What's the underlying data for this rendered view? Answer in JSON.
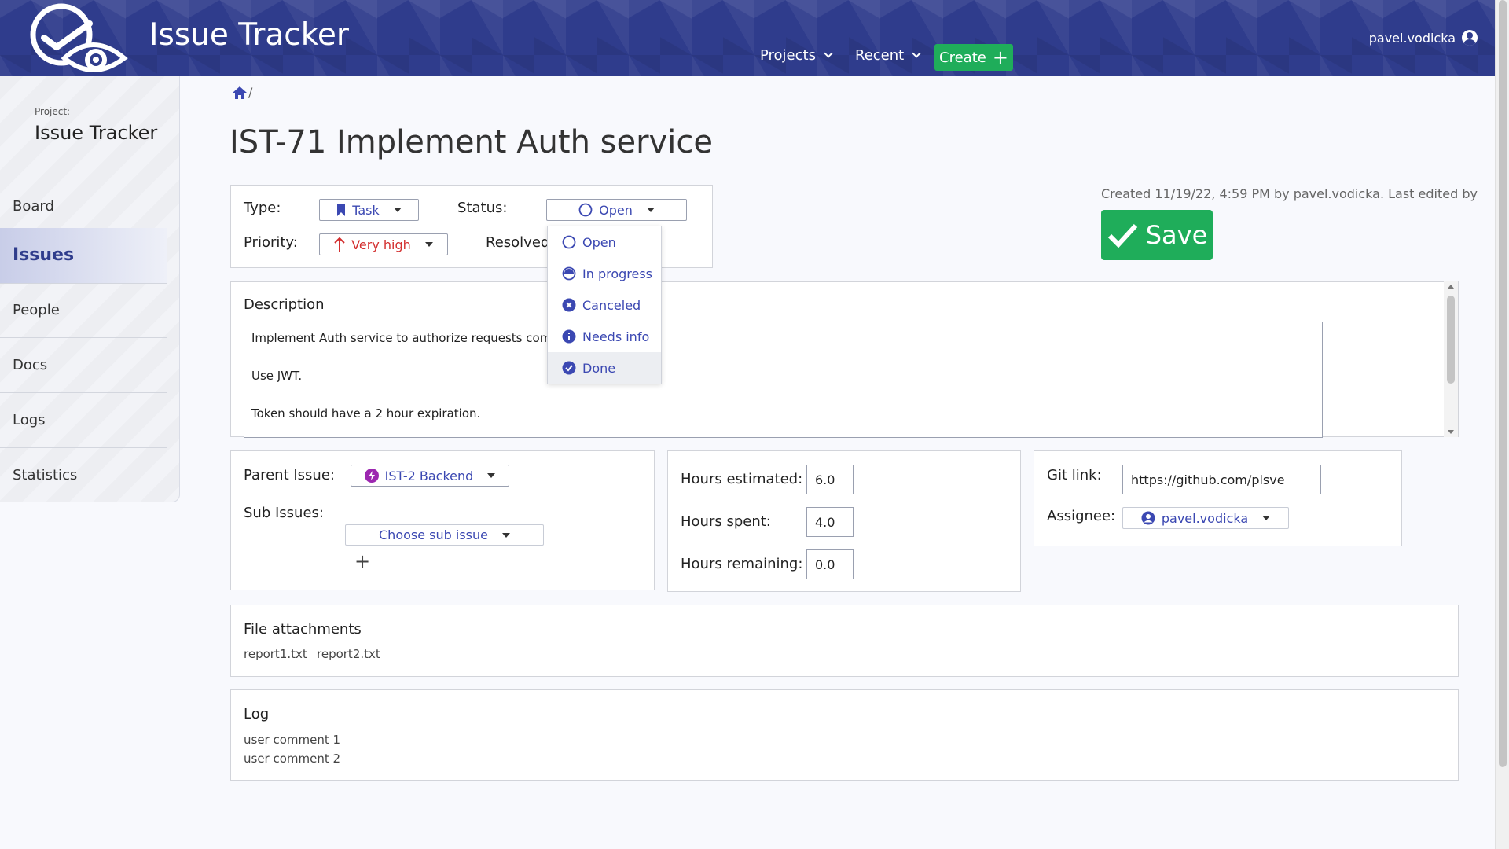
{
  "header": {
    "app_title": "Issue Tracker",
    "nav": {
      "projects": "Projects",
      "recent": "Recent",
      "create": "Create"
    },
    "user": "pavel.vodicka"
  },
  "sidebar": {
    "project_label": "Project:",
    "project_name": "Issue Tracker",
    "items": [
      {
        "label": "Board"
      },
      {
        "label": "Issues"
      },
      {
        "label": "People"
      },
      {
        "label": "Docs"
      },
      {
        "label": "Logs"
      },
      {
        "label": "Statistics"
      }
    ]
  },
  "breadcrumb": {
    "sep": "/"
  },
  "issue": {
    "title": "IST-71 Implement Auth service",
    "type_label": "Type:",
    "type_value": "Task",
    "status_label": "Status:",
    "status_value": "Open",
    "priority_label": "Priority:",
    "priority_value": "Very high",
    "resolved_label": "Resolved:",
    "meta": "Created 11/19/22, 4:59 PM by pavel.vodicka.  Last edited by",
    "save_label": "Save"
  },
  "status_menu": {
    "options": [
      "Open",
      "In progress",
      "Canceled",
      "Needs info",
      "Done"
    ]
  },
  "description": {
    "title": "Description",
    "lines": [
      "Implement Auth service to authorize requests coming",
      "Use JWT.",
      "Token should have a 2 hour expiration."
    ]
  },
  "relations": {
    "parent_label": "Parent Issue:",
    "parent_value": "IST-2  Backend",
    "sub_label": "Sub Issues:",
    "sub_placeholder": "Choose sub issue",
    "add": "+"
  },
  "hours": {
    "estimated_label": "Hours estimated:",
    "estimated": "6.0",
    "spent_label": "Hours spent:",
    "spent": "4.0",
    "remaining_label": "Hours remaining:",
    "remaining": "0.0"
  },
  "git": {
    "link_label": "Git link:",
    "link_value": "https://github.com/plsve",
    "assignee_label": "Assignee:",
    "assignee_value": "pavel.vodicka"
  },
  "attachments": {
    "title": "File attachments",
    "files": [
      "report1.txt",
      "report2.txt"
    ]
  },
  "log": {
    "title": "Log",
    "entries": [
      "user comment 1",
      "user comment 2"
    ]
  },
  "colors": {
    "header_bg": "#2f3c8c",
    "accent": "#3b48b2",
    "save_green": "#1fad5a",
    "priority_red": "#d32f2f"
  }
}
